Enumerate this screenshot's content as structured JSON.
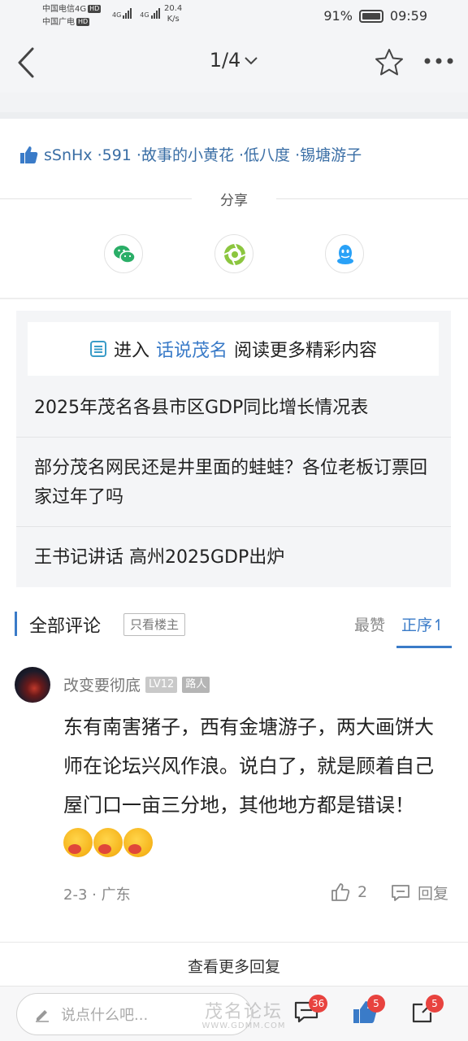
{
  "status_bar": {
    "carrier1": "中国电信4G",
    "carrier2": "中国广电",
    "hd": "HD",
    "net1": "4G",
    "net2": "4G",
    "speed_value": "20.4",
    "speed_unit": "K/s",
    "battery": "91%",
    "time": "09:59"
  },
  "navbar": {
    "page_indicator": "1/4"
  },
  "likes": {
    "text": "sSnHx ·591 ·故事的小黄花 ·低八度 ·锡塘游子"
  },
  "share": {
    "title": "分享",
    "icons": [
      "wechat-icon",
      "moments-icon",
      "qq-icon"
    ]
  },
  "related": {
    "prefix": "进入",
    "forum": "话说茂名",
    "suffix": "阅读更多精彩内容",
    "items": [
      "2025年茂名各县市区GDP同比增长情况表",
      "部分茂名网民还是井里面的蛙蛙？各位老板订票回家过年了吗",
      "王书记讲话 高州2025GDP出炉"
    ]
  },
  "comments": {
    "title": "全部评论",
    "only_op": "只看楼主",
    "sort_hot": "最赞",
    "sort_order": "正序",
    "sort_arrow": "↿",
    "items": [
      {
        "user": "改变要彻底",
        "level": "LV12",
        "rank": "路人",
        "text": "东有南害猪子，西有金塘游子，两大画饼大师在论坛兴风作浪。说白了，就是顾着自己屋门口一亩三分地，其他地方都是错误！",
        "meta": "2-3 · 广东",
        "likes": "2",
        "reply_label": "回复"
      }
    ],
    "more_replies": "查看更多回复"
  },
  "bottom_bar": {
    "input_placeholder": "说点什么吧...",
    "comment_count": "36",
    "like_count": "5",
    "share_count": "5"
  },
  "watermark": {
    "main": "茂名论坛",
    "url": "WWW.GDMM.COM"
  },
  "colors": {
    "accent": "#3a7bc8",
    "badge_red": "#e8433f",
    "wechat_green": "#2aae67",
    "qq_blue": "#29a1f7"
  }
}
